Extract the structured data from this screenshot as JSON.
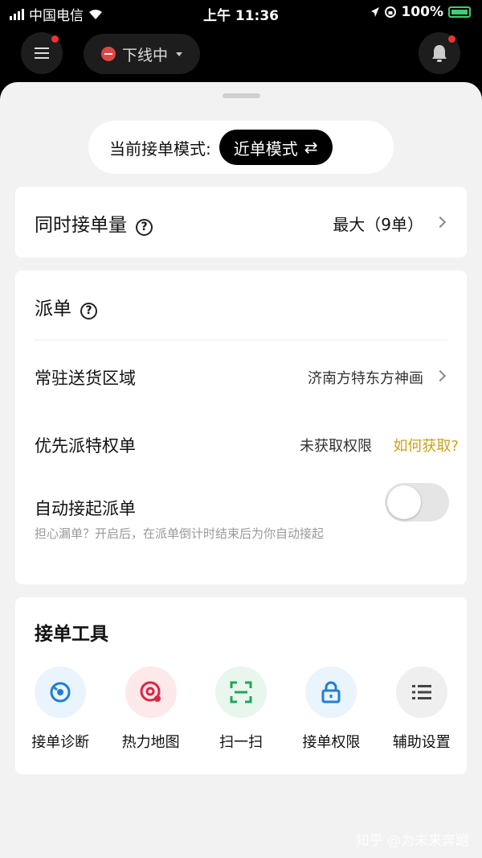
{
  "status_bar": {
    "carrier": "中国电信",
    "time": "上午 11:36",
    "battery": "100%"
  },
  "top_bar": {
    "status_label": "下线中"
  },
  "mode": {
    "label": "当前接单模式:",
    "value": "近单模式",
    "switch_glyph": "⇄"
  },
  "concurrent": {
    "title": "同时接单量",
    "value": "最大（9单）"
  },
  "dispatch": {
    "title": "派单",
    "area_label": "常驻送货区域",
    "area_value": "济南方特东方神画",
    "priority_label": "优先派特权单",
    "priority_value": "未获取权限",
    "priority_link": "如何获取?",
    "auto_label": "自动接起派单",
    "auto_desc": "担心漏单？开启后，在派单倒计时结束后为你自动接起",
    "auto_enabled": false
  },
  "tools": {
    "title": "接单工具",
    "items": [
      {
        "label": "接单诊断",
        "icon": "diagnosis-icon",
        "bg": "#eaf4fc",
        "color": "#1e7fd6"
      },
      {
        "label": "热力地图",
        "icon": "heatmap-icon",
        "bg": "#fde8ea",
        "color": "#e0253f"
      },
      {
        "label": "扫一扫",
        "icon": "scan-icon",
        "bg": "#e8f6ee",
        "color": "#1fa55c"
      },
      {
        "label": "接单权限",
        "icon": "lock-icon",
        "bg": "#eaf4fc",
        "color": "#1e7fd6"
      },
      {
        "label": "辅助设置",
        "icon": "list-icon",
        "bg": "#efefef",
        "color": "#444444"
      }
    ]
  },
  "watermark": "知乎 @为未来奔跑"
}
